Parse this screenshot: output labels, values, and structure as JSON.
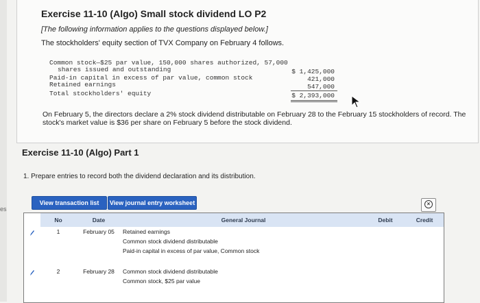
{
  "side_text": "es",
  "title": "Exercise 11-10 (Algo) Small stock dividend LO P2",
  "subtitle": "[The following information applies to the questions displayed below.]",
  "intro": "The stockholders' equity section of TVX Company on February 4 follows.",
  "equity": {
    "line1": "Common stock—$25 par value, 150,000 shares authorized, 57,000",
    "line2": "shares issued and outstanding",
    "line3": "Paid-in capital in excess of par value, common stock",
    "line4": "Retained earnings",
    "line5": "Total stockholders' equity",
    "val1": "$ 1,425,000",
    "val2": "421,000",
    "val3": "547,000",
    "val4": "$ 2,393,000"
  },
  "paragraph": "On February 5, the directors declare a 2% stock dividend distributable on February 28 to the February 15 stockholders of record. The stock's market value is $36 per share on February 5 before the stock dividend.",
  "part_title": "Exercise 11-10 (Algo) Part 1",
  "question": "1. Prepare entries to record both the dividend declaration and its distribution.",
  "buttons": {
    "view_transaction_list": "View transaction list",
    "view_journal_entry_worksheet": "View journal entry worksheet"
  },
  "close_label": "×",
  "table": {
    "headers": {
      "no": "No",
      "date": "Date",
      "general_journal": "General Journal",
      "debit": "Debit",
      "credit": "Credit"
    },
    "entries": [
      {
        "no": "1",
        "date": "February 05",
        "lines": [
          "Retained earnings",
          "Common stock dividend distributable",
          "Paid-in capital in excess of par value, Common stock"
        ]
      },
      {
        "no": "2",
        "date": "February 28",
        "lines": [
          "Common stock dividend distributable",
          "Common stock, $25 par value"
        ]
      }
    ]
  }
}
